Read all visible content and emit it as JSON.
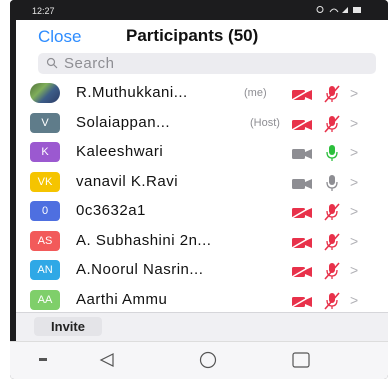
{
  "status": {
    "time": "12:27",
    "icons": [
      "alarm-icon",
      "wifi-icon",
      "signal-icon",
      "battery-icon"
    ]
  },
  "header": {
    "close_label": "Close",
    "title": "Participants (50)"
  },
  "search": {
    "placeholder": "Search",
    "value": ""
  },
  "colors": {
    "accent": "#2d8cff",
    "muted_red": "#e8314a",
    "mic_green": "#2cbf3c",
    "icon_gray": "#8e8e93"
  },
  "participants": [
    {
      "initials": "",
      "avatar_type": "photo",
      "avatar_color": "",
      "name": "R.Muthukkani...",
      "tag": "(me)",
      "camera": "off",
      "mic": "muted"
    },
    {
      "initials": "V",
      "avatar_type": "initials",
      "avatar_color": "#5f7c8a",
      "name": "Solaiappan...",
      "tag": "(Host)",
      "camera": "off",
      "mic": "muted"
    },
    {
      "initials": "K",
      "avatar_type": "initials",
      "avatar_color": "#9b59d0",
      "name": "Kaleeshwari",
      "tag": "",
      "camera": "gray",
      "mic": "active"
    },
    {
      "initials": "VK",
      "avatar_type": "initials",
      "avatar_color": "#f5c400",
      "name": "vanavil K.Ravi",
      "tag": "",
      "camera": "gray",
      "mic": "gray"
    },
    {
      "initials": "0",
      "avatar_type": "initials",
      "avatar_color": "#4e6fe0",
      "name": "0c3632a1",
      "tag": "",
      "camera": "off",
      "mic": "muted"
    },
    {
      "initials": "AS",
      "avatar_type": "initials",
      "avatar_color": "#f25a5a",
      "name": "A. Subhashini 2n...",
      "tag": "",
      "camera": "off",
      "mic": "muted"
    },
    {
      "initials": "AN",
      "avatar_type": "initials",
      "avatar_color": "#2fa8e6",
      "name": "A.Noorul Nasrin...",
      "tag": "",
      "camera": "off",
      "mic": "muted"
    },
    {
      "initials": "AA",
      "avatar_type": "initials",
      "avatar_color": "#7fcf6a",
      "name": "Aarthi Ammu",
      "tag": "",
      "camera": "off",
      "mic": "muted"
    }
  ],
  "footer": {
    "invite_label": "Invite"
  },
  "nav": [
    "menu-icon",
    "back-icon",
    "home-icon",
    "recents-icon"
  ]
}
